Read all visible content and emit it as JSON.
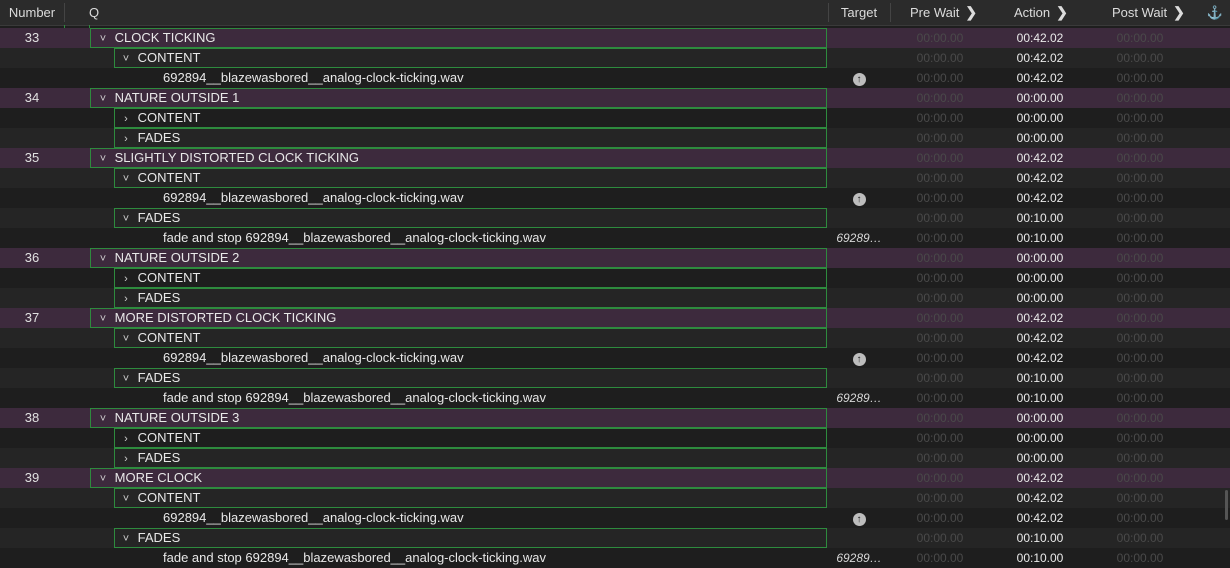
{
  "header": {
    "number": "Number",
    "q": "Q",
    "target": "Target",
    "pre_wait": "Pre Wait",
    "action": "Action",
    "post_wait": "Post Wait",
    "chevron": "❯",
    "anchor_icon": "⚓"
  },
  "rows": [
    {
      "kind": "group",
      "number": "33",
      "label": "CLOCK TICKING",
      "level": 0,
      "disc": "˅",
      "target": "",
      "pre": "00:00.00",
      "action": "00:42.02",
      "post": "00:00.00"
    },
    {
      "kind": "sub",
      "number": "",
      "label": "CONTENT",
      "level": 1,
      "disc": "˅",
      "target": "",
      "pre": "00:00.00",
      "action": "00:42.02",
      "post": "00:00.00"
    },
    {
      "kind": "sub",
      "number": "",
      "label": "692894__blazewasbored__analog-clock-ticking.wav",
      "level": 2,
      "disc": "",
      "target": "up",
      "pre": "00:00.00",
      "action": "00:42.02",
      "post": "00:00.00"
    },
    {
      "kind": "group",
      "number": "34",
      "label": "NATURE OUTSIDE 1",
      "level": 0,
      "disc": "˅",
      "target": "",
      "pre": "00:00.00",
      "action": "00:00.00",
      "post": "00:00.00"
    },
    {
      "kind": "sub",
      "number": "",
      "label": "CONTENT",
      "level": 1,
      "disc": "›",
      "target": "",
      "pre": "00:00.00",
      "action": "00:00.00",
      "post": "00:00.00"
    },
    {
      "kind": "sub",
      "number": "",
      "label": "FADES",
      "level": 1,
      "disc": "›",
      "target": "",
      "pre": "00:00.00",
      "action": "00:00.00",
      "post": "00:00.00"
    },
    {
      "kind": "group",
      "number": "35",
      "label": "SLIGHTLY DISTORTED CLOCK TICKING",
      "level": 0,
      "disc": "˅",
      "target": "",
      "pre": "00:00.00",
      "action": "00:42.02",
      "post": "00:00.00"
    },
    {
      "kind": "sub",
      "number": "",
      "label": "CONTENT",
      "level": 1,
      "disc": "˅",
      "target": "",
      "pre": "00:00.00",
      "action": "00:42.02",
      "post": "00:00.00"
    },
    {
      "kind": "sub",
      "number": "",
      "label": "692894__blazewasbored__analog-clock-ticking.wav",
      "level": 2,
      "disc": "",
      "target": "up",
      "pre": "00:00.00",
      "action": "00:42.02",
      "post": "00:00.00"
    },
    {
      "kind": "sub",
      "number": "",
      "label": "FADES",
      "level": 1,
      "disc": "˅",
      "target": "",
      "pre": "00:00.00",
      "action": "00:10.00",
      "post": "00:00.00"
    },
    {
      "kind": "sub",
      "number": "",
      "label": "fade and stop 692894__blazewasbored__analog-clock-ticking.wav",
      "level": 2,
      "disc": "",
      "target": "69289…",
      "pre": "00:00.00",
      "action": "00:10.00",
      "post": "00:00.00"
    },
    {
      "kind": "group",
      "number": "36",
      "label": "NATURE OUTSIDE 2",
      "level": 0,
      "disc": "˅",
      "target": "",
      "pre": "00:00.00",
      "action": "00:00.00",
      "post": "00:00.00"
    },
    {
      "kind": "sub",
      "number": "",
      "label": "CONTENT",
      "level": 1,
      "disc": "›",
      "target": "",
      "pre": "00:00.00",
      "action": "00:00.00",
      "post": "00:00.00"
    },
    {
      "kind": "sub",
      "number": "",
      "label": "FADES",
      "level": 1,
      "disc": "›",
      "target": "",
      "pre": "00:00.00",
      "action": "00:00.00",
      "post": "00:00.00"
    },
    {
      "kind": "group",
      "number": "37",
      "label": "MORE DISTORTED CLOCK TICKING",
      "level": 0,
      "disc": "˅",
      "target": "",
      "pre": "00:00.00",
      "action": "00:42.02",
      "post": "00:00.00"
    },
    {
      "kind": "sub",
      "number": "",
      "label": "CONTENT",
      "level": 1,
      "disc": "˅",
      "target": "",
      "pre": "00:00.00",
      "action": "00:42.02",
      "post": "00:00.00"
    },
    {
      "kind": "sub",
      "number": "",
      "label": "692894__blazewasbored__analog-clock-ticking.wav",
      "level": 2,
      "disc": "",
      "target": "up",
      "pre": "00:00.00",
      "action": "00:42.02",
      "post": "00:00.00"
    },
    {
      "kind": "sub",
      "number": "",
      "label": "FADES",
      "level": 1,
      "disc": "˅",
      "target": "",
      "pre": "00:00.00",
      "action": "00:10.00",
      "post": "00:00.00"
    },
    {
      "kind": "sub",
      "number": "",
      "label": "fade and stop 692894__blazewasbored__analog-clock-ticking.wav",
      "level": 2,
      "disc": "",
      "target": "69289…",
      "pre": "00:00.00",
      "action": "00:10.00",
      "post": "00:00.00"
    },
    {
      "kind": "group",
      "number": "38",
      "label": "NATURE OUTSIDE 3",
      "level": 0,
      "disc": "˅",
      "target": "",
      "pre": "00:00.00",
      "action": "00:00.00",
      "post": "00:00.00"
    },
    {
      "kind": "sub",
      "number": "",
      "label": "CONTENT",
      "level": 1,
      "disc": "›",
      "target": "",
      "pre": "00:00.00",
      "action": "00:00.00",
      "post": "00:00.00"
    },
    {
      "kind": "sub",
      "number": "",
      "label": "FADES",
      "level": 1,
      "disc": "›",
      "target": "",
      "pre": "00:00.00",
      "action": "00:00.00",
      "post": "00:00.00"
    },
    {
      "kind": "group",
      "number": "39",
      "label": "MORE CLOCK",
      "level": 0,
      "disc": "˅",
      "target": "",
      "pre": "00:00.00",
      "action": "00:42.02",
      "post": "00:00.00"
    },
    {
      "kind": "sub",
      "number": "",
      "label": "CONTENT",
      "level": 1,
      "disc": "˅",
      "target": "",
      "pre": "00:00.00",
      "action": "00:42.02",
      "post": "00:00.00"
    },
    {
      "kind": "sub",
      "number": "",
      "label": "692894__blazewasbored__analog-clock-ticking.wav",
      "level": 2,
      "disc": "",
      "target": "up",
      "pre": "00:00.00",
      "action": "00:42.02",
      "post": "00:00.00"
    },
    {
      "kind": "sub",
      "number": "",
      "label": "FADES",
      "level": 1,
      "disc": "˅",
      "target": "",
      "pre": "00:00.00",
      "action": "00:10.00",
      "post": "00:00.00"
    },
    {
      "kind": "sub",
      "number": "",
      "label": "fade and stop 692894__blazewasbored__analog-clock-ticking.wav",
      "level": 2,
      "disc": "",
      "target": "69289…",
      "pre": "00:00.00",
      "action": "00:10.00",
      "post": "00:00.00"
    }
  ],
  "colors": {
    "group_row": "#3d2a3d",
    "group_border": "#2e8b3e",
    "header_bg": "#2b2b2b",
    "dim_time": "#4a4a4a"
  }
}
